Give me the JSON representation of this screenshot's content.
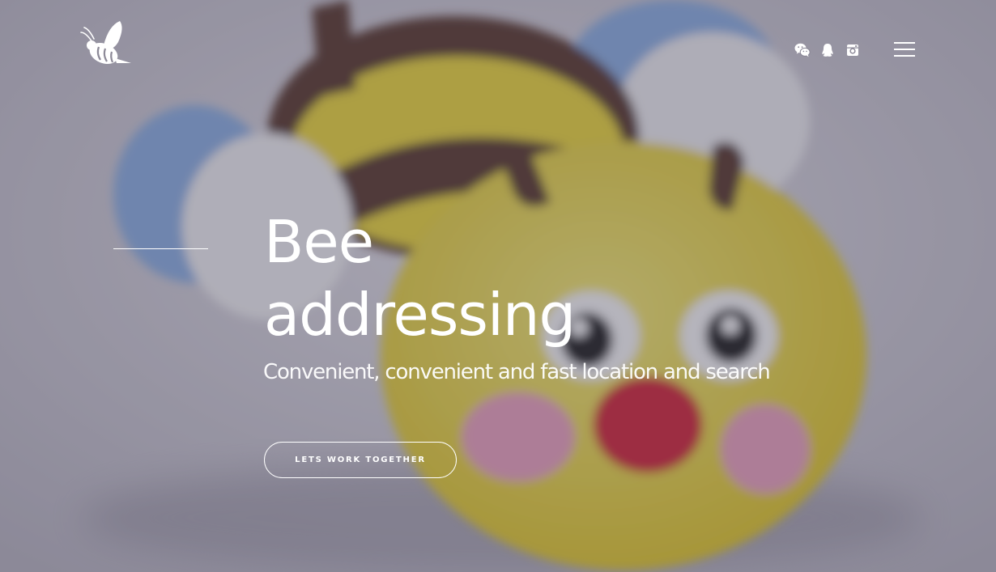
{
  "header": {
    "logo_icon": "bee-logo-icon",
    "social_icons": [
      {
        "name": "wechat-icon"
      },
      {
        "name": "qq-icon"
      },
      {
        "name": "instagram-icon"
      }
    ],
    "menu_icon": "hamburger-menu-icon"
  },
  "hero": {
    "title_line1": "Bee",
    "title_line2": "addressing",
    "subtitle": "Convenient, convenient and fast location and search",
    "cta_label": "LETS WORK TOGETHER"
  },
  "colors": {
    "text": "#ffffff",
    "bee_yellow": "#f5e13f",
    "bee_brown": "#5b3a2e",
    "cheek_pink": "#f2a7c3",
    "nose_red": "#d8273b",
    "wing_blue": "#8fb4e8"
  }
}
